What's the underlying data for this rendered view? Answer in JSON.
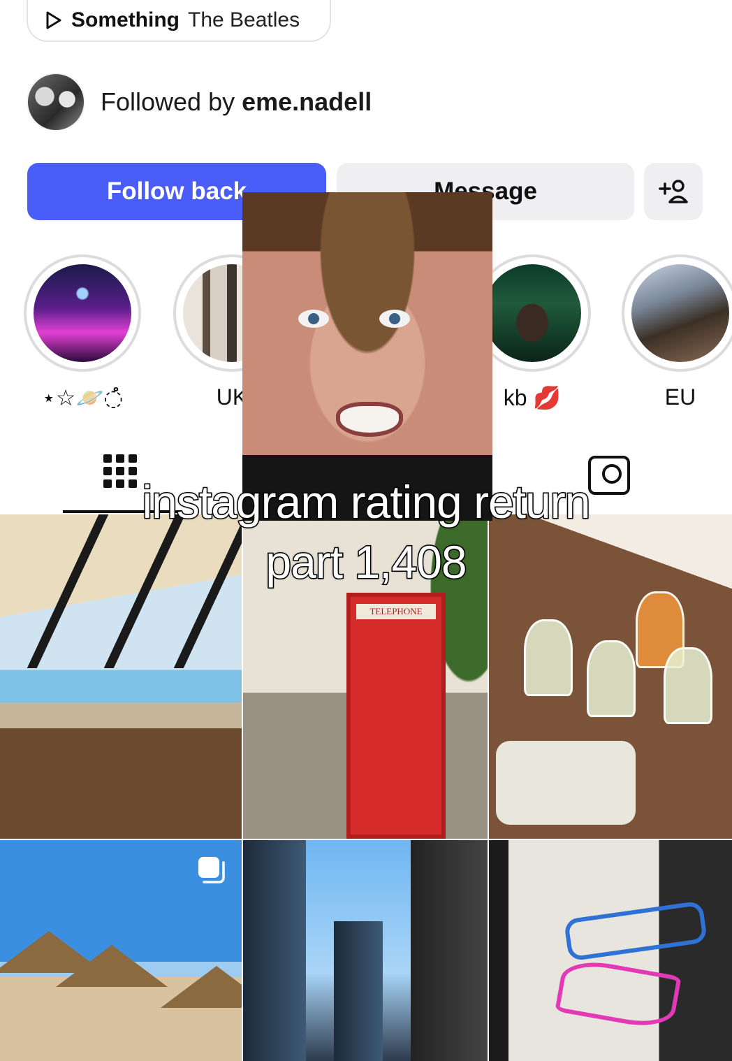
{
  "music": {
    "song": "Something",
    "artist": "The Beatles"
  },
  "followed": {
    "prefix": "Followed by ",
    "user": "eme.nadell"
  },
  "buttons": {
    "follow": "Follow back",
    "message": "Message",
    "add_user": "+8"
  },
  "highlights": [
    {
      "label": "⋆☆🪐◌ໍ"
    },
    {
      "label": "UK"
    },
    {
      "label": "kb 💋"
    },
    {
      "label": "EU"
    }
  ],
  "overlay": {
    "line1": "instagram rating return",
    "line2": "part 1,408"
  },
  "booth_sign": "TELEPHONE",
  "colors": {
    "accent": "#4a5df9",
    "button_gray": "#efeff1"
  }
}
